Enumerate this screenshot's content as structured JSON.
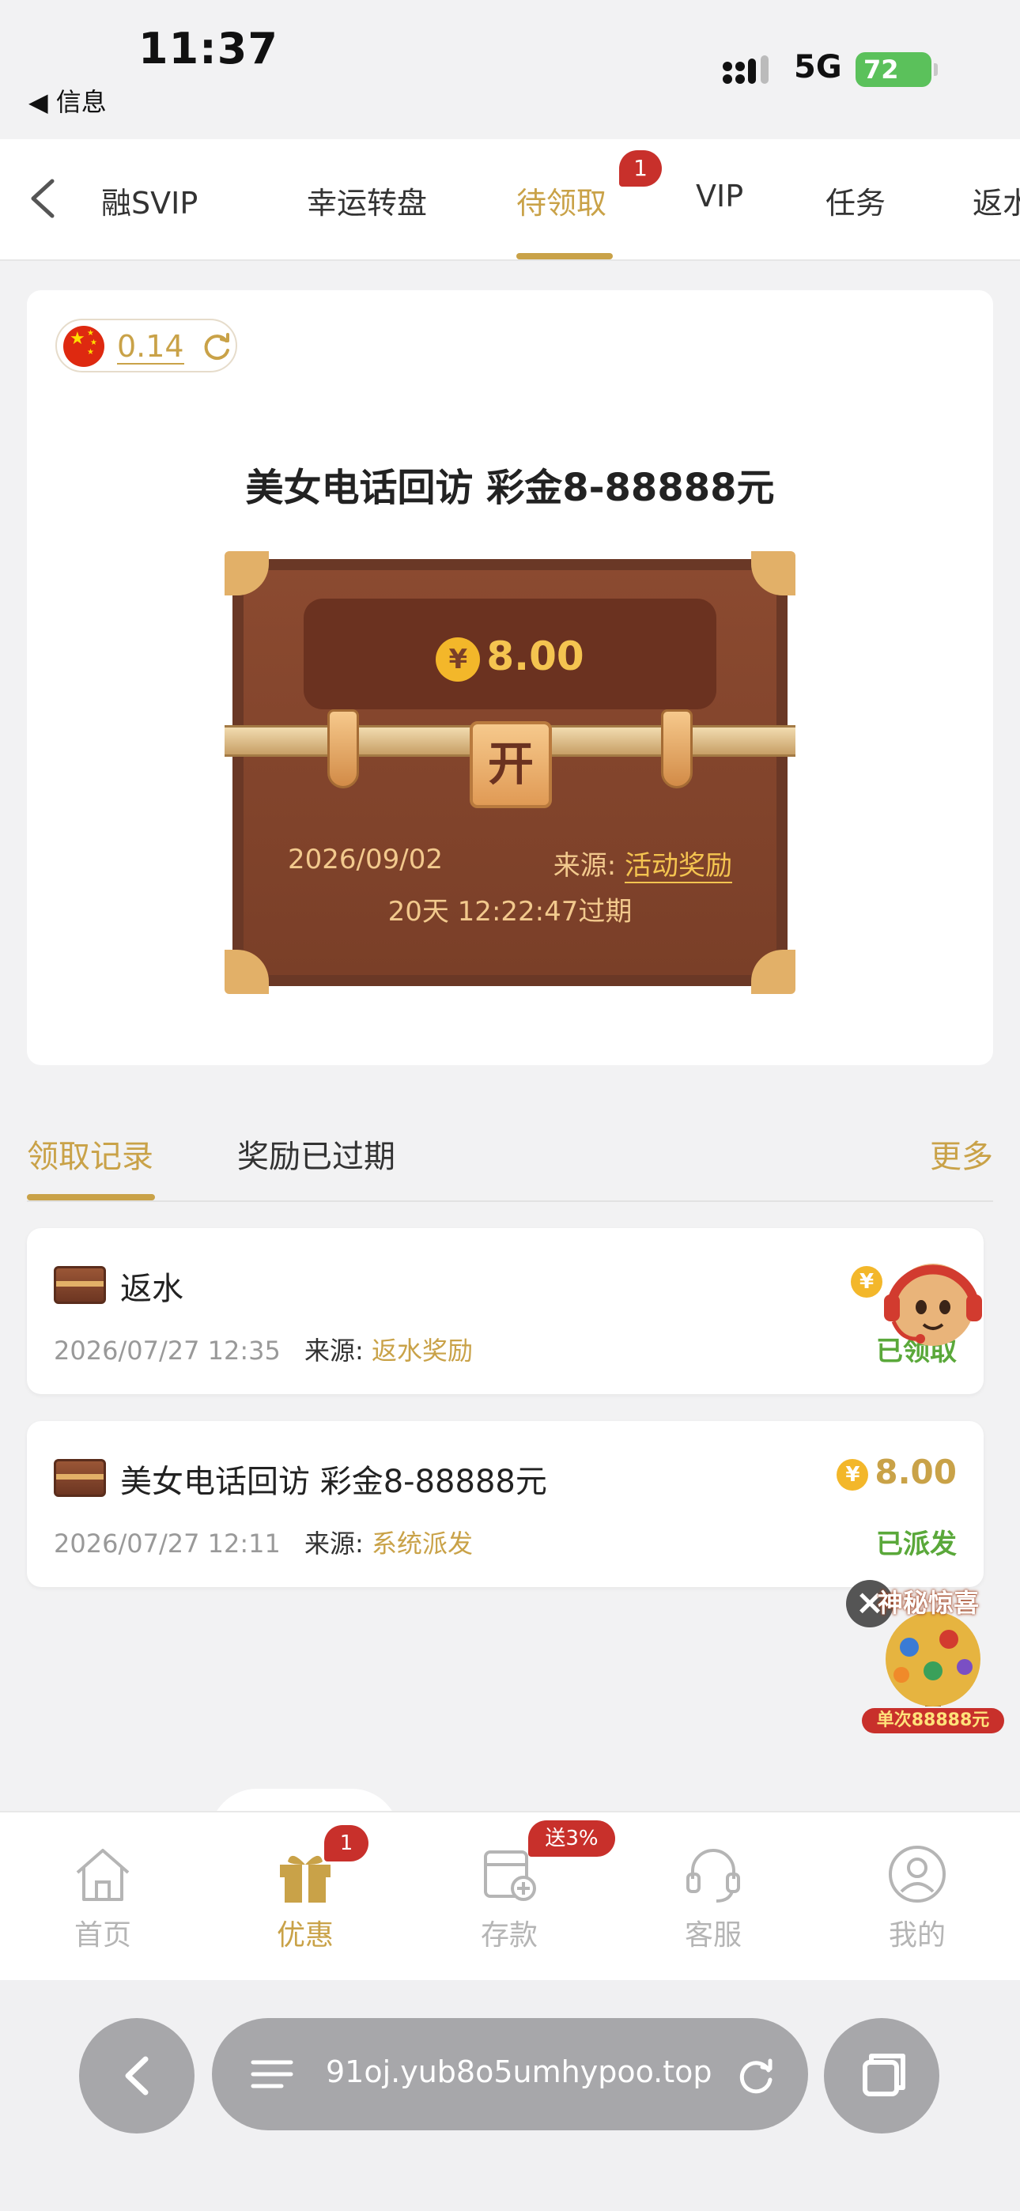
{
  "status_bar": {
    "time": "11:37",
    "back_app": "◀ 信息",
    "network": "5G",
    "battery": "72"
  },
  "tabs": [
    "融SVIP",
    "幸运转盘",
    "待领取",
    "VIP",
    "任务",
    "返水"
  ],
  "tabs_badge": "1",
  "card": {
    "balance": "0.14",
    "title": "美女电话回访 彩金8-88888元",
    "chest": {
      "currency_symbol": "¥",
      "amount": "8.00",
      "lock_label": "开",
      "date": "2026/09/02",
      "source_label": "来源:",
      "source": "活动奖励",
      "expire": "20天 12:22:47过期"
    }
  },
  "records_tabs": {
    "tab1": "领取记录",
    "tab2": "奖励已过期",
    "more": "更多"
  },
  "records": [
    {
      "title": "返水",
      "time": "2026/07/27 12:35",
      "source_label": "来源:",
      "source": "返水奖励",
      "currency_symbol": "¥",
      "amount": "",
      "status": "已领取"
    },
    {
      "title": "美女电话回访 彩金8-88888元",
      "time": "2026/07/27 12:11",
      "source_label": "来源:",
      "source": "系统派发",
      "currency_symbol": "¥",
      "amount": "8.00",
      "status": "已派发"
    }
  ],
  "promo": {
    "label": "神秘惊喜",
    "amount": "单次88888元"
  },
  "bottom_nav": {
    "items": [
      "首页",
      "优惠",
      "存款",
      "客服",
      "我的"
    ],
    "offers_badge": "1",
    "deposit_badge": "送3%"
  },
  "browser": {
    "url": "91oj.yub8o5umhypoo.top"
  },
  "colors": {
    "accent": "#c9a248",
    "badge": "#c8302b",
    "success": "#5aa83a"
  }
}
